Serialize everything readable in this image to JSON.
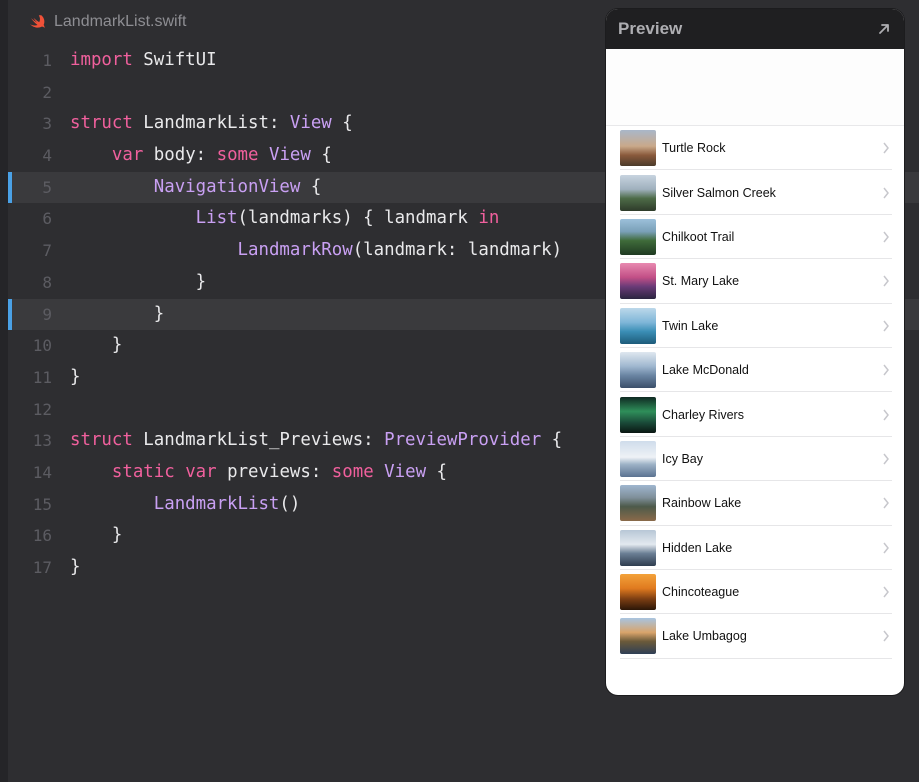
{
  "file_tab": {
    "icon": "swift-icon",
    "name": "LandmarkList.swift"
  },
  "code_lines": [
    {
      "n": "1",
      "tokens": [
        [
          "kw",
          "import"
        ],
        [
          "plain",
          " SwiftUI"
        ]
      ]
    },
    {
      "n": "2",
      "tokens": []
    },
    {
      "n": "3",
      "tokens": [
        [
          "kw",
          "struct"
        ],
        [
          "plain",
          " LandmarkList: "
        ],
        [
          "type",
          "View"
        ],
        [
          "plain",
          " {"
        ]
      ]
    },
    {
      "n": "4",
      "tokens": [
        [
          "plain",
          "    "
        ],
        [
          "kw",
          "var"
        ],
        [
          "plain",
          " body: "
        ],
        [
          "kw",
          "some"
        ],
        [
          "plain",
          " "
        ],
        [
          "type",
          "View"
        ],
        [
          "plain",
          " {"
        ]
      ]
    },
    {
      "n": "5",
      "tokens": [
        [
          "plain",
          "        "
        ],
        [
          "type",
          "NavigationView"
        ],
        [
          "plain",
          " {"
        ]
      ],
      "highlighted": true
    },
    {
      "n": "6",
      "tokens": [
        [
          "plain",
          "            "
        ],
        [
          "type",
          "List"
        ],
        [
          "plain",
          "(landmarks) { landmark "
        ],
        [
          "kw",
          "in"
        ]
      ]
    },
    {
      "n": "7",
      "tokens": [
        [
          "plain",
          "                "
        ],
        [
          "type",
          "LandmarkRow"
        ],
        [
          "plain",
          "(landmark: landmark)"
        ]
      ]
    },
    {
      "n": "8",
      "tokens": [
        [
          "plain",
          "            }"
        ]
      ]
    },
    {
      "n": "9",
      "tokens": [
        [
          "plain",
          "        }"
        ]
      ],
      "highlighted": true
    },
    {
      "n": "10",
      "tokens": [
        [
          "plain",
          "    }"
        ]
      ]
    },
    {
      "n": "11",
      "tokens": [
        [
          "plain",
          "}"
        ]
      ]
    },
    {
      "n": "12",
      "tokens": []
    },
    {
      "n": "13",
      "tokens": [
        [
          "kw",
          "struct"
        ],
        [
          "plain",
          " LandmarkList_Previews: "
        ],
        [
          "type",
          "PreviewProvider"
        ],
        [
          "plain",
          " {"
        ]
      ]
    },
    {
      "n": "14",
      "tokens": [
        [
          "plain",
          "    "
        ],
        [
          "kw",
          "static"
        ],
        [
          "plain",
          " "
        ],
        [
          "kw",
          "var"
        ],
        [
          "plain",
          " previews: "
        ],
        [
          "kw",
          "some"
        ],
        [
          "plain",
          " "
        ],
        [
          "type",
          "View"
        ],
        [
          "plain",
          " {"
        ]
      ]
    },
    {
      "n": "15",
      "tokens": [
        [
          "plain",
          "        "
        ],
        [
          "type",
          "LandmarkList"
        ],
        [
          "plain",
          "()"
        ]
      ]
    },
    {
      "n": "16",
      "tokens": [
        [
          "plain",
          "    }"
        ]
      ]
    },
    {
      "n": "17",
      "tokens": [
        [
          "plain",
          "}"
        ]
      ]
    }
  ],
  "colors": {
    "keyword": "#f0609d",
    "type": "#c9a0f3",
    "plain": "#e9e9eb",
    "line_highlight_marker": "#4aa1e6"
  },
  "preview": {
    "title": "Preview",
    "expand_icon": "expand-arrow-icon",
    "items": [
      {
        "label": "Turtle Rock",
        "thumb": "linear-gradient(180deg,#a9b7c9 0%,#c9a98a 45%,#8a5a3c 70%,#4b3a2a 100%)"
      },
      {
        "label": "Silver Salmon Creek",
        "thumb": "linear-gradient(180deg,#c7d3df 0%,#9fb0bd 40%,#4d6b47 65%,#2e3b2a 100%)"
      },
      {
        "label": "Chilkoot Trail",
        "thumb": "linear-gradient(180deg,#9cc0da 0%,#7aa0b8 35%,#3f6b3a 60%,#1f3a22 100%)"
      },
      {
        "label": "St. Mary Lake",
        "thumb": "linear-gradient(180deg,#e88ab0 0%,#c24f86 40%,#6b3b78 65%,#2b2540 100%)"
      },
      {
        "label": "Twin Lake",
        "thumb": "linear-gradient(180deg,#bcd8ea 0%,#7fb6d8 40%,#3b8fb6 65%,#1d5b7a 100%)"
      },
      {
        "label": "Lake McDonald",
        "thumb": "linear-gradient(180deg,#dfe7ef 0%,#9fb7cf 40%,#6a85a3 65%,#3b4f6a 100%)"
      },
      {
        "label": "Charley Rivers",
        "thumb": "linear-gradient(180deg,#0f2a22 0%,#2f8f5a 40%,#1b4d3a 70%,#0a1612 100%)"
      },
      {
        "label": "Icy Bay",
        "thumb": "linear-gradient(180deg,#cfdceb 0%,#eef2f6 45%,#9db2c6 65%,#5b7391 100%)"
      },
      {
        "label": "Rainbow Lake",
        "thumb": "linear-gradient(180deg,#9fb6cf 0%,#7f8f9a 35%,#4d5a4a 60%,#8a6a4a 100%)"
      },
      {
        "label": "Hidden Lake",
        "thumb": "linear-gradient(180deg,#b8c7d6 0%,#e3e9ef 40%,#6b7f95 65%,#2f3d4f 100%)"
      },
      {
        "label": "Chincoteague",
        "thumb": "linear-gradient(180deg,#f3a23a 0%,#e07a1f 40%,#7a3d12 70%,#2b1608 100%)"
      },
      {
        "label": "Lake Umbagog",
        "thumb": "linear-gradient(180deg,#a8c4e0 0%,#d9a46b 40%,#6b5a3a 65%,#2f3f55 100%)"
      }
    ]
  }
}
